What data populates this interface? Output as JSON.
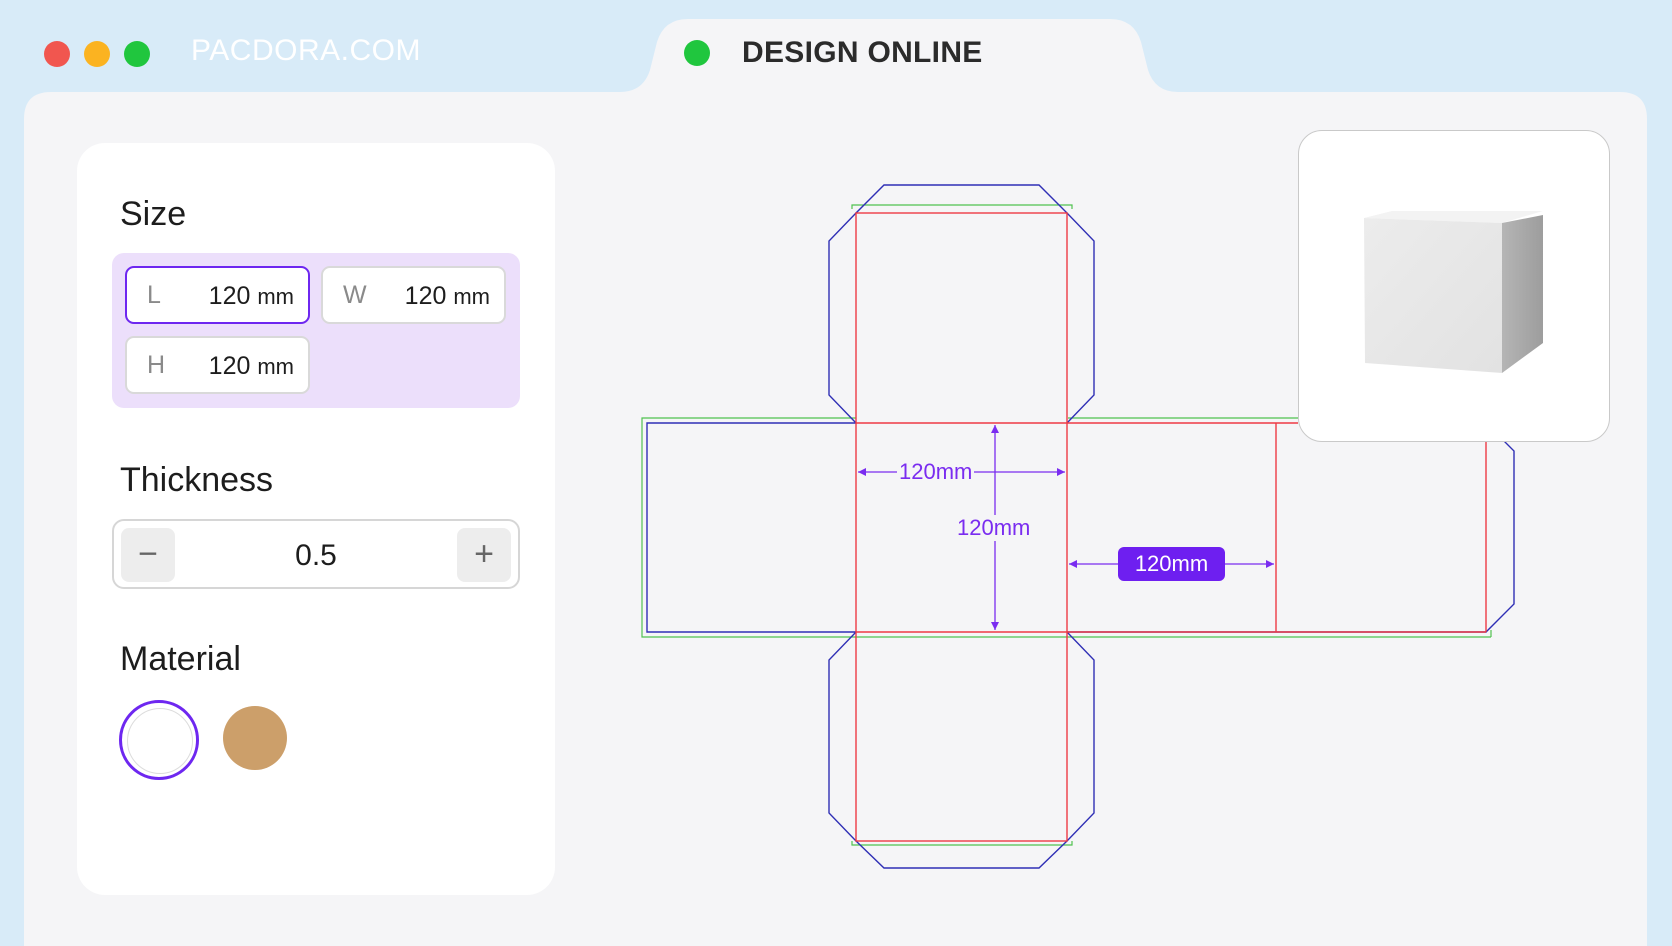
{
  "browser": {
    "site_url": "PACDORA.COM",
    "tab_title": "DESIGN ONLINE"
  },
  "panel": {
    "size_title": "Size",
    "dimensions": [
      {
        "key": "L",
        "value": "120",
        "unit": "mm",
        "active": true
      },
      {
        "key": "W",
        "value": "120",
        "unit": "mm",
        "active": false
      },
      {
        "key": "H",
        "value": "120",
        "unit": "mm",
        "active": false
      }
    ],
    "thickness_title": "Thickness",
    "thickness": {
      "value": "0.5",
      "minus": "−",
      "plus": "+"
    },
    "material_title": "Material",
    "materials": [
      {
        "name": "white",
        "color": "#ffffff",
        "selected": true
      },
      {
        "name": "kraft",
        "color": "#cc9f6a",
        "selected": false
      }
    ]
  },
  "dieline": {
    "label_width": "120mm",
    "label_height": "120mm",
    "label_side": "120mm",
    "colors": {
      "cut": "#2f2fb5",
      "fold": "#ee3a45",
      "bleed": "#4fc24f",
      "dimension": "#7a2cf0"
    }
  },
  "colors": {
    "background": "#d8ebf8",
    "window": "#f5f5f7",
    "accent": "#6e27f0"
  }
}
